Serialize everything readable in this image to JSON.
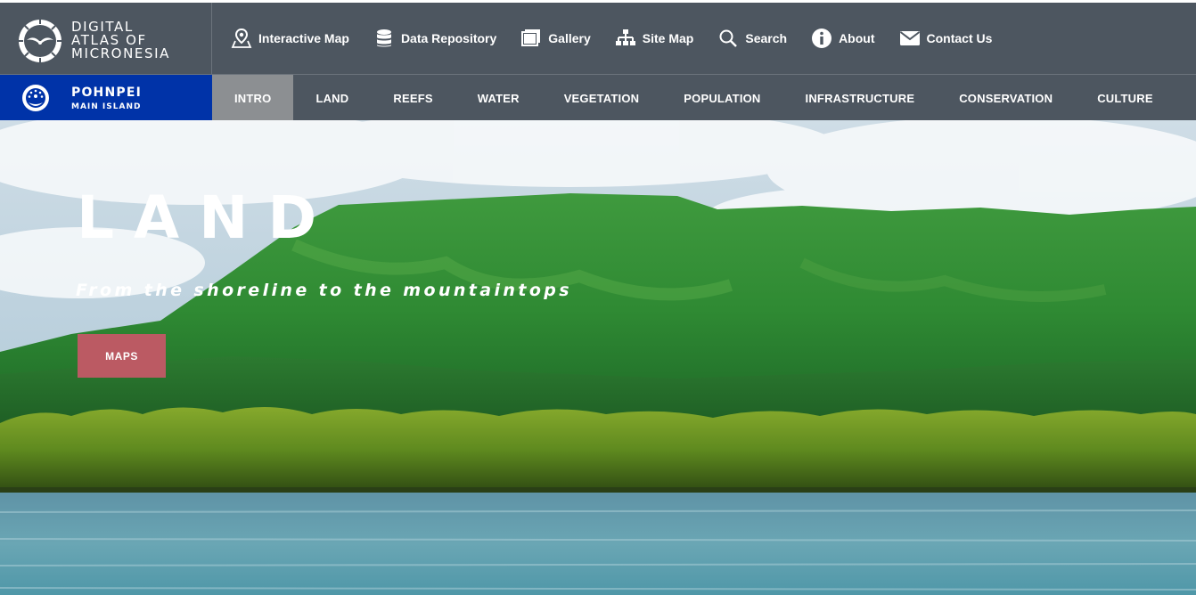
{
  "brand": {
    "line1": "DIGITAL",
    "line2": "ATLAS OF",
    "line3": "MICRONESIA",
    "icon": "frigatebird-logo-icon"
  },
  "utility_nav": [
    {
      "label": "Interactive Map",
      "icon": "map-pin-icon"
    },
    {
      "label": "Data Repository",
      "icon": "database-icon"
    },
    {
      "label": "Gallery",
      "icon": "gallery-icon"
    },
    {
      "label": "Site Map",
      "icon": "sitemap-icon"
    },
    {
      "label": "Search",
      "icon": "search-icon"
    },
    {
      "label": "About",
      "icon": "info-icon"
    },
    {
      "label": "Contact Us",
      "icon": "envelope-icon"
    }
  ],
  "island": {
    "name": "POHNPEI",
    "subtitle": "MAIN ISLAND",
    "icon": "pohnpei-seal-icon"
  },
  "section_tabs": [
    {
      "label": "INTRO",
      "active": true
    },
    {
      "label": "LAND",
      "active": false
    },
    {
      "label": "REEFS",
      "active": false
    },
    {
      "label": "WATER",
      "active": false
    },
    {
      "label": "VEGETATION",
      "active": false
    },
    {
      "label": "POPULATION",
      "active": false
    },
    {
      "label": "INFRASTRUCTURE",
      "active": false
    },
    {
      "label": "CONSERVATION",
      "active": false
    },
    {
      "label": "CULTURE",
      "active": false
    }
  ],
  "hero": {
    "title": "LAND",
    "subtitle": "From the shoreline to the mountaintops",
    "button_label": "MAPS"
  },
  "colors": {
    "topbar": "#4d5660",
    "island_bar": "#0033a8",
    "active_tab": "#8c8f92",
    "button": "#bb5a63"
  }
}
